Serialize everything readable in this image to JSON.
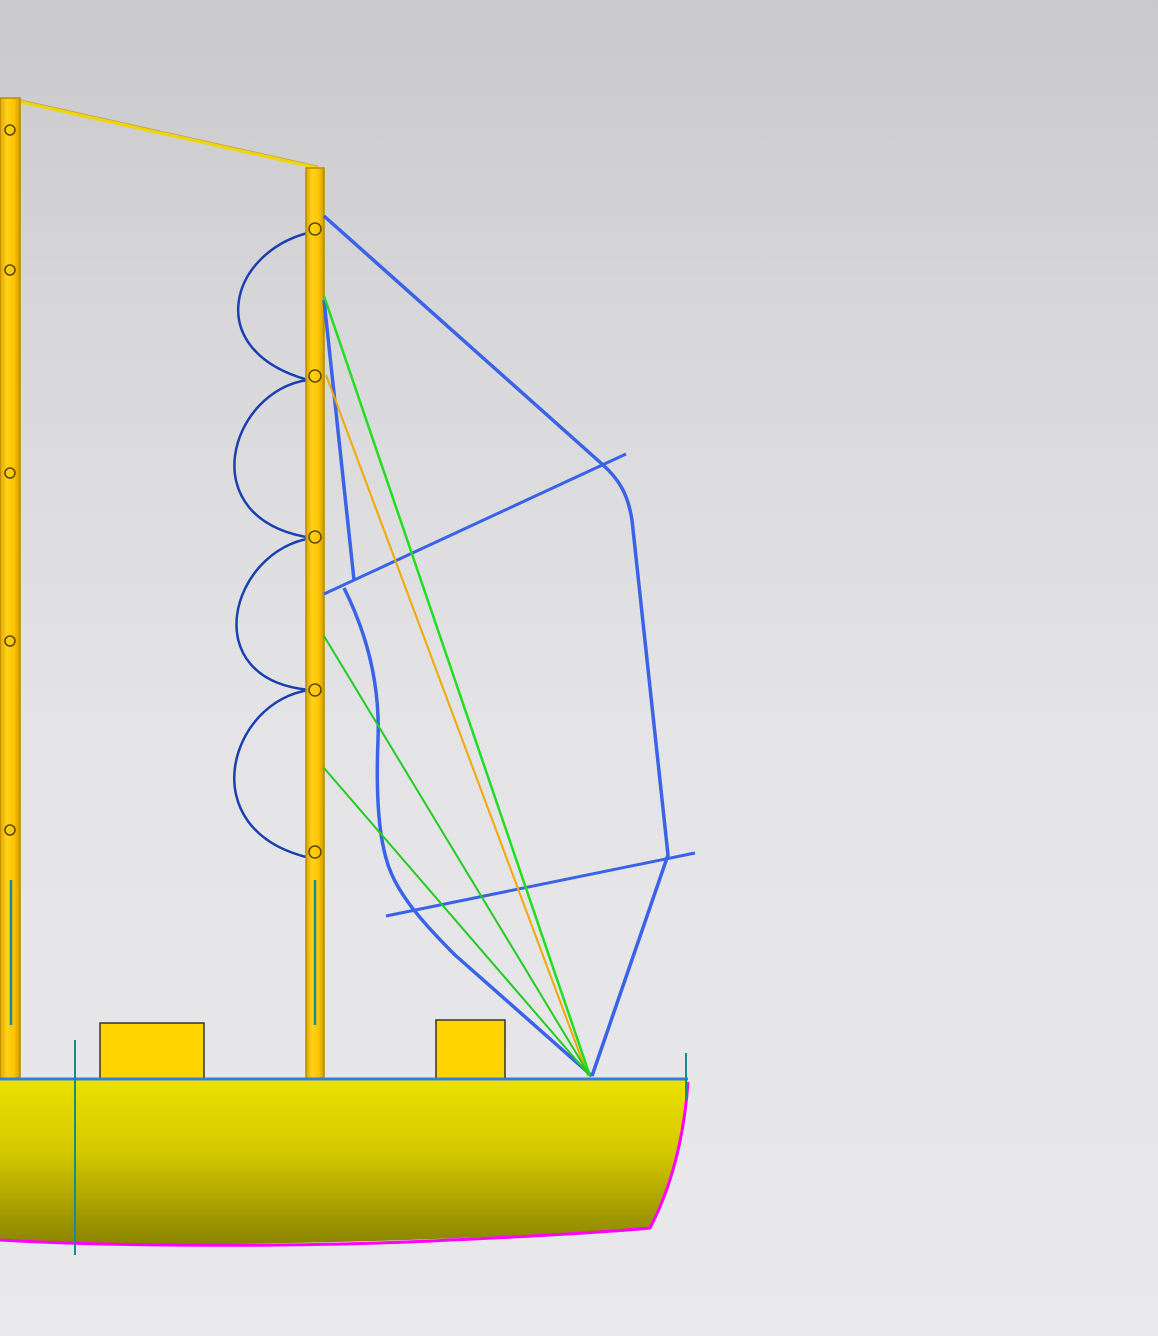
{
  "scene": {
    "name": "sailboat-rig-cad-view",
    "colors": {
      "background_top": "#c9c9cb",
      "background_bottom": "#e9e9eb",
      "mast_fill": "#ffcc00",
      "mast_outline": "#c89800",
      "hull_top": "#e8dd00",
      "hull_bottom": "#8a8400",
      "hull_keel_line": "#ff00ff",
      "deck_line": "#2f7fe0",
      "deckhouse_fill": "#ffd400",
      "sail_outline": "#3a63e8",
      "mast_hoops": "#1a3fb0",
      "sheet_green": "#22dd22",
      "sheet_orange": "#f0a800",
      "stay_yellow": "#f2d400",
      "guide_teal": "#1b8a8a"
    },
    "components": [
      "aft-mast",
      "forward-mast",
      "triatic-stay",
      "mast-hoops",
      "sail-outline",
      "battens",
      "sheet-lines",
      "deckhouses",
      "hull",
      "waterline-markers"
    ]
  }
}
